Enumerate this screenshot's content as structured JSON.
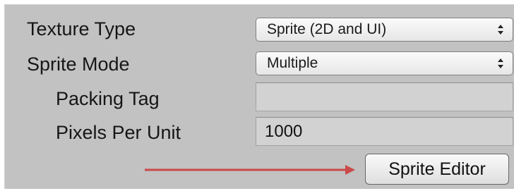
{
  "import_settings": {
    "texture_type": {
      "label": "Texture Type",
      "value": "Sprite (2D and UI)",
      "icon": "updown-icon"
    },
    "sprite_mode": {
      "label": "Sprite Mode",
      "value": "Multiple",
      "icon": "updown-icon"
    },
    "packing_tag": {
      "label": "Packing Tag",
      "value": ""
    },
    "pixels_per_unit": {
      "label": "Pixels Per Unit",
      "value": "1000"
    },
    "sprite_editor_button": {
      "label": "Sprite Editor"
    },
    "annotation": {
      "icon": "arrow-right-icon",
      "color": "#c94a4a"
    }
  },
  "colors": {
    "panel_background": "#c2c2c2",
    "field_background": "#d2d2d2",
    "text": "#161616"
  }
}
